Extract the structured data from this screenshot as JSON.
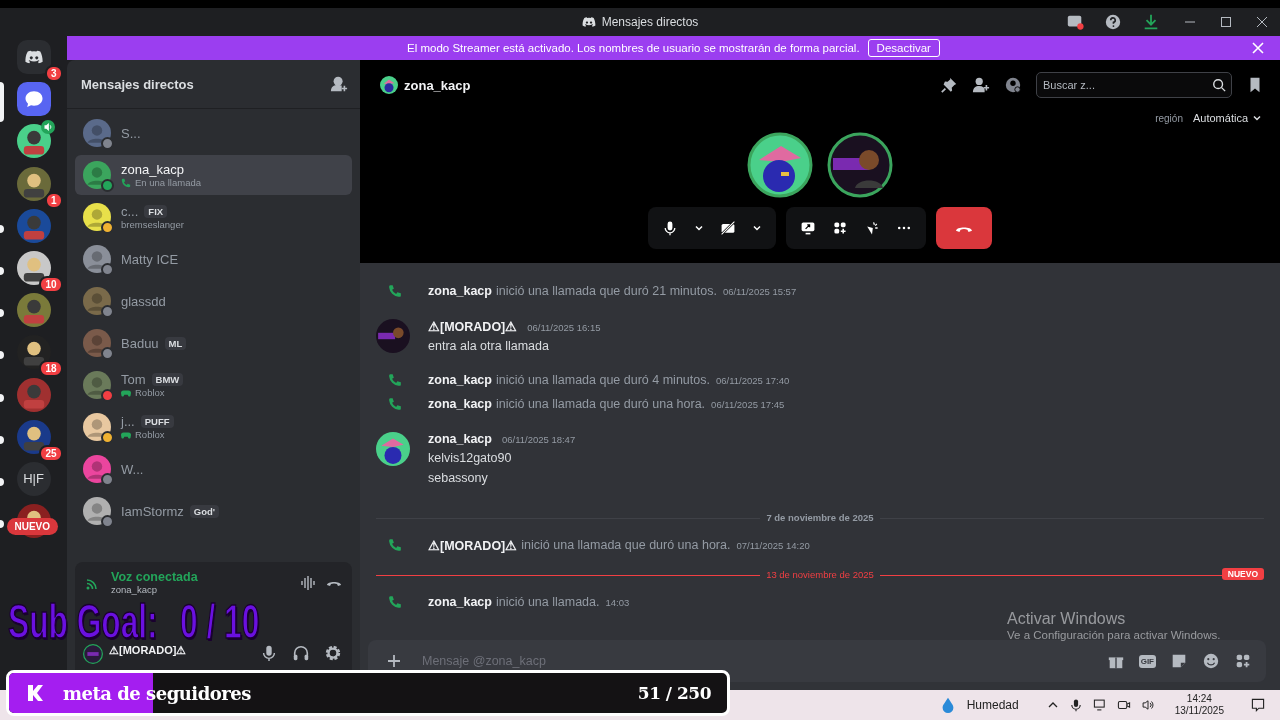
{
  "window": {
    "title": "Mensajes directos"
  },
  "banner": {
    "text": "El modo Streamer está activado. Los nombres de usuario se mostrarán de forma parcial.",
    "button": "Desactivar"
  },
  "servers": [
    {
      "kind": "discord",
      "badge": "3",
      "selected": false,
      "unread": false
    },
    {
      "kind": "messages",
      "selected": true,
      "unread": false
    },
    {
      "kind": "picture",
      "voice": true,
      "selected": false,
      "unread": false
    },
    {
      "kind": "picture",
      "badge": "1",
      "selected": false,
      "unread": false
    },
    {
      "kind": "picture",
      "selected": false,
      "unread": true
    },
    {
      "kind": "picture",
      "badge": "10",
      "selected": false,
      "unread": true
    },
    {
      "kind": "picture",
      "selected": false,
      "unread": true
    },
    {
      "kind": "picture",
      "badge": "18",
      "selected": false,
      "unread": true
    },
    {
      "kind": "picture",
      "selected": false,
      "unread": true
    },
    {
      "kind": "picture",
      "badge": "25",
      "selected": false,
      "unread": true
    },
    {
      "kind": "text",
      "label": "H|F",
      "selected": false,
      "unread": true
    },
    {
      "kind": "picture",
      "new_label": "NUEVO",
      "selected": false,
      "unread": true
    }
  ],
  "dm_panel": {
    "title": "Mensajes directos",
    "items": [
      {
        "name": "S...",
        "color": "#80848e",
        "selected": false
      },
      {
        "name": "zona_kacp",
        "subtitle": {
          "kind": "call",
          "text": "En una llamada"
        },
        "color": "#23a55a",
        "selected": true
      },
      {
        "name": "c...",
        "tag": "FIX",
        "subtitle": {
          "kind": "text",
          "text": "bremseslanger"
        },
        "color": "#f0b232",
        "selected": false
      },
      {
        "name": "Matty ICE",
        "color": "#80848e",
        "selected": false
      },
      {
        "name": "glassdd",
        "color": "#80848e",
        "selected": false
      },
      {
        "name": "Baduu",
        "tag": "ML",
        "color": "#80848e",
        "selected": false
      },
      {
        "name": "Tom",
        "tag": "BMW",
        "subtitle": {
          "kind": "game",
          "text": "Roblox"
        },
        "color": "#f23f43",
        "selected": false
      },
      {
        "name": "j...",
        "tag": "PUFF",
        "subtitle": {
          "kind": "game",
          "text": "Roblox"
        },
        "color": "#f0b232",
        "selected": false
      },
      {
        "name": "W...",
        "color": "#80848e",
        "selected": false
      },
      {
        "name": "IamStormz",
        "tag": "God'",
        "color": "#80848e",
        "selected": false
      }
    ]
  },
  "voice": {
    "status": "Voz conectada",
    "channel": "zona_kacp"
  },
  "user": {
    "name": "⚠[MORADO]⚠"
  },
  "header": {
    "name": "zona_kacp",
    "search_placeholder": "Buscar z...",
    "region_label": "región",
    "region_value": "Automática"
  },
  "messages": [
    {
      "kind": "call",
      "author": "zona_kacp",
      "text": "inició una llamada que duró 21 minutos.",
      "time": "06/11/2025 15:57"
    },
    {
      "kind": "message",
      "author": "⚠[MORADO]⚠",
      "avatar": {
        "kind": "dark"
      },
      "time": "06/11/2025 16:15",
      "lines": [
        "entra ala otra llamada"
      ]
    },
    {
      "kind": "call",
      "author": "zona_kacp",
      "text": "inició una llamada que duró 4 minutos.",
      "time": "06/11/2025 17:40"
    },
    {
      "kind": "call",
      "author": "zona_kacp",
      "text": "inició una llamada que duró una hora.",
      "time": "06/11/2025 17:45"
    },
    {
      "kind": "message",
      "author": "zona_kacp",
      "avatar": {
        "kind": "green"
      },
      "time": "06/11/2025 18:47",
      "lines": [
        "kelvis12gato90",
        "sebassony"
      ]
    },
    {
      "kind": "divider",
      "text": "7 de noviembre de 2025"
    },
    {
      "kind": "call",
      "author": "⚠[MORADO]⚠",
      "text": "inició una llamada que duró una hora.",
      "time": "07/11/2025 14:20"
    },
    {
      "kind": "new_divider",
      "text": "13 de noviembre de 2025",
      "badge": "NUEVO"
    },
    {
      "kind": "call",
      "author": "zona_kacp",
      "text": "inició una llamada.",
      "time": "14:03"
    }
  ],
  "composer": {
    "placeholder": "Mensaje @zona_kacp",
    "gif": "GIF"
  },
  "activation": {
    "title": "Activar Windows",
    "text": "Ve a Configuración para activar Windows."
  },
  "sub_goal": {
    "label": "Sub Goal:",
    "value": "0 / 10"
  },
  "follower_goal": {
    "label": "meta de seguidores",
    "count": "51 / 250",
    "level": 0.2
  },
  "taskbar": {
    "weather": "Humedad",
    "time": "14:24",
    "date": "13/11/2025"
  }
}
